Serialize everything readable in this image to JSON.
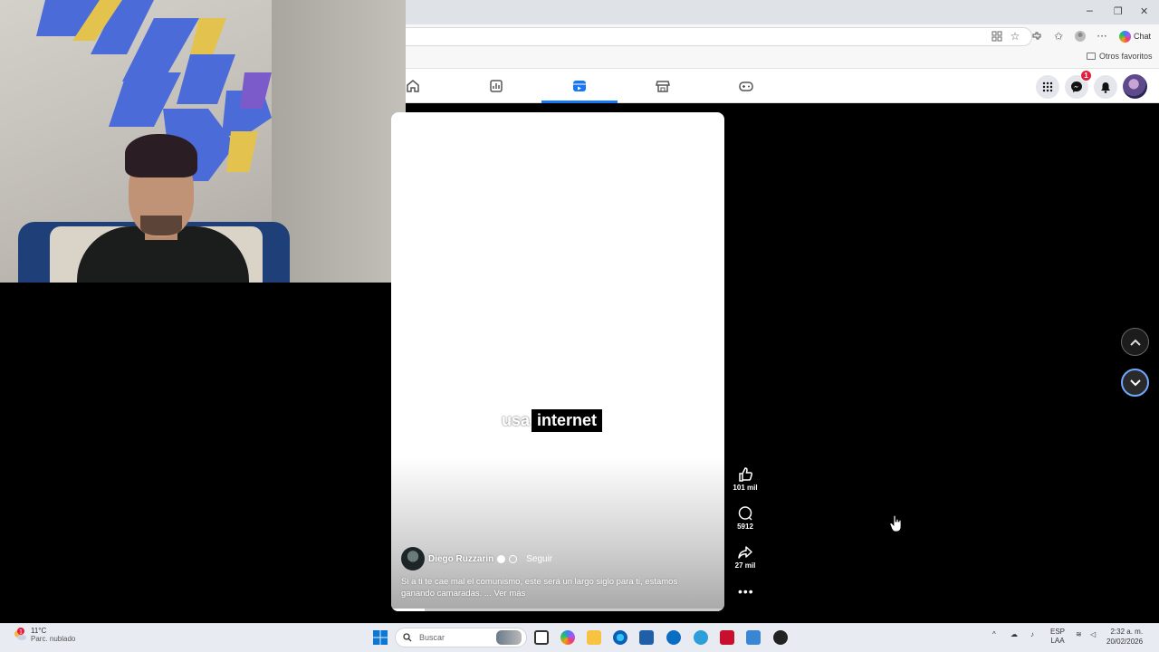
{
  "browser": {
    "window_controls": {
      "minimize": "─",
      "restore": "❐",
      "close": "✕"
    },
    "toolbar_icons": [
      "apps-icon",
      "star-icon",
      "extensions-icon",
      "favorites-icon",
      "profile-icon",
      "more-icon"
    ],
    "chat_label": "Chat",
    "favorites_folder": "Otros favoritos"
  },
  "facebook": {
    "nav_tabs": [
      "home",
      "feeds",
      "reels",
      "marketplace",
      "gaming"
    ],
    "active_tab": "reels",
    "notification_badge": "1"
  },
  "reel": {
    "caption_word1": "usa",
    "caption_word2": "internet",
    "author": "Diego Ruzzarin",
    "follow": "Seguir",
    "description": "Si a ti te cae mal el comunismo, este será un largo siglo para ti, estamos ganando camaradas. ... Ver más",
    "progress": 0.1,
    "likes": "101 mil",
    "comments": "5912",
    "shares": "27 mil"
  },
  "taskbar": {
    "temperature": "11°C",
    "weather": "Parc. nublado",
    "weather_badge": "1",
    "search_placeholder": "Buscar",
    "language": "ESP",
    "language_sub": "LAA",
    "time": "2:32 a. m.",
    "date": "20/02/2026"
  },
  "colors": {
    "accent": "#1877f2",
    "badge": "#e41e3f",
    "down_ring": "#6fa8ff"
  }
}
